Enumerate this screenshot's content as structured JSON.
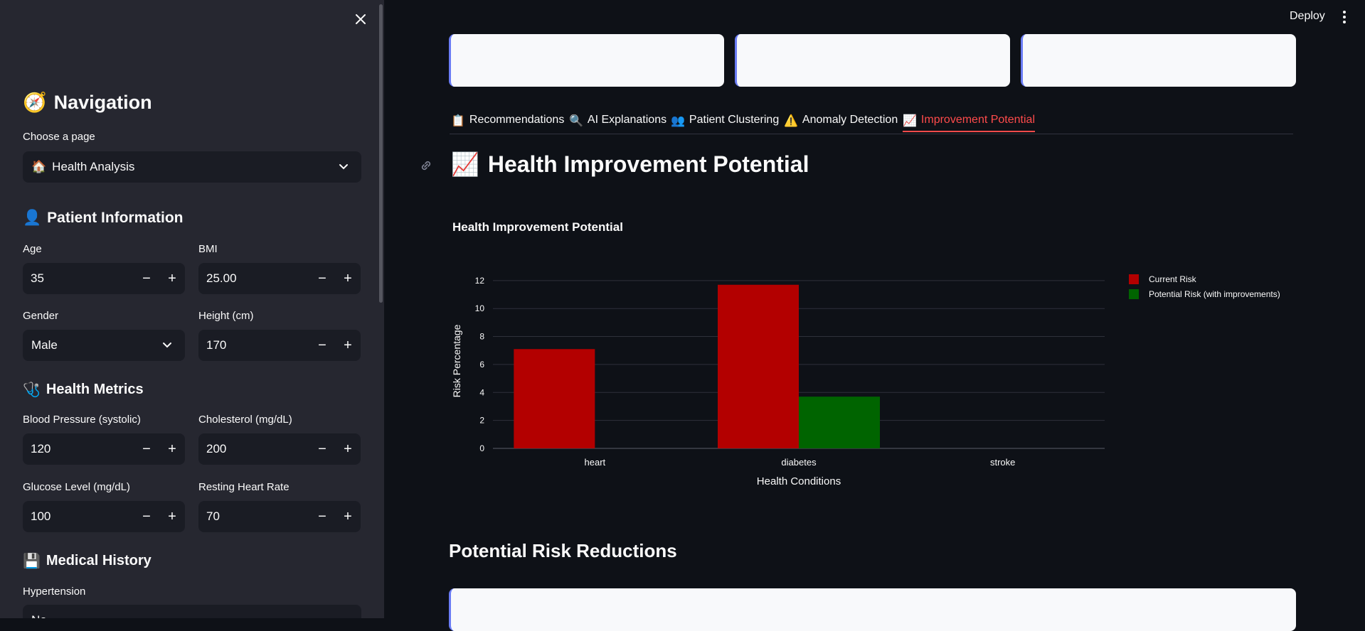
{
  "sidebar": {
    "close_label": "✕",
    "navigation": {
      "icon": "🧭",
      "title": "Navigation",
      "choose_label": "Choose a page",
      "page_icon": "🏠",
      "page_value": "Health Analysis"
    },
    "patient_info": {
      "icon": "👤",
      "title": "Patient Information",
      "age": {
        "label": "Age",
        "value": "35"
      },
      "bmi": {
        "label": "BMI",
        "value": "25.00"
      },
      "gender": {
        "label": "Gender",
        "value": "Male"
      },
      "height": {
        "label": "Height (cm)",
        "value": "170"
      }
    },
    "health_metrics": {
      "icon": "🩺",
      "title": "Health Metrics",
      "bp": {
        "label": "Blood Pressure (systolic)",
        "value": "120"
      },
      "cholesterol": {
        "label": "Cholesterol (mg/dL)",
        "value": "200"
      },
      "glucose": {
        "label": "Glucose Level (mg/dL)",
        "value": "100"
      },
      "heart_rate": {
        "label": "Resting Heart Rate",
        "value": "70"
      }
    },
    "medical_history": {
      "icon": "💾",
      "title": "Medical History",
      "hypertension_label": "Hypertension",
      "hypertension_value": "No"
    },
    "stepper": {
      "minus": "−",
      "plus": "+"
    }
  },
  "header": {
    "deploy_label": "Deploy"
  },
  "tabs": [
    {
      "icon": "📋",
      "label": "Recommendations"
    },
    {
      "icon": "🔍",
      "label": "AI Explanations"
    },
    {
      "icon": "👥",
      "label": "Patient Clustering"
    },
    {
      "icon": "⚠️",
      "label": "Anomaly Detection"
    },
    {
      "icon": "📈",
      "label": "Improvement Potential"
    }
  ],
  "active_tab_index": 4,
  "main": {
    "title_icon": "📈",
    "title": "Health Improvement Potential",
    "section_title": "Potential Risk Reductions"
  },
  "colors": {
    "accent": "#ff4b4b",
    "current_risk": "#b30000",
    "potential_risk": "#006400"
  },
  "chart_data": {
    "type": "bar",
    "title": "Health Improvement Potential",
    "categories": [
      "heart",
      "diabetes",
      "stroke"
    ],
    "series": [
      {
        "name": "Current Risk",
        "values": [
          7.1,
          11.7,
          0
        ],
        "color": "#b30000"
      },
      {
        "name": "Potential Risk (with improvements)",
        "values": [
          0,
          3.7,
          0
        ],
        "color": "#006400"
      }
    ],
    "xlabel": "Health Conditions",
    "ylabel": "Risk Percentage",
    "ylim": [
      0,
      12.5
    ],
    "yticks": [
      0,
      2,
      4,
      6,
      8,
      10,
      12
    ],
    "grid": true,
    "legend_position": "top-right"
  }
}
